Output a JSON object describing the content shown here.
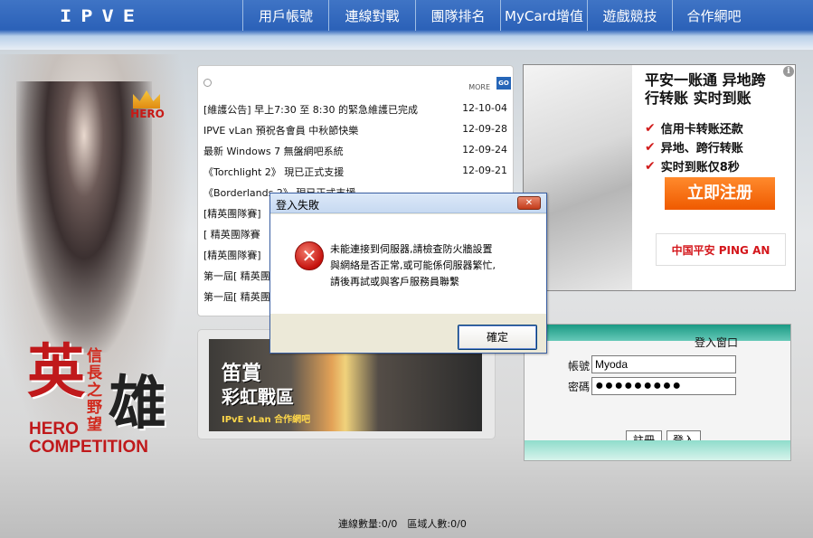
{
  "header": {
    "logo": "IPVE",
    "nav": [
      "用戶帳號",
      "連線對戰",
      "團隊排名",
      "MyCard增值",
      "遊戲競技",
      "合作網吧"
    ]
  },
  "hero": {
    "badge": "HERO",
    "title_char_1": "英",
    "title_char_2": "雄",
    "subtitle": "信長之野望",
    "competition_1": "HERO",
    "competition_2": "COMPETITION"
  },
  "news": {
    "more_label": "MORE",
    "go_label": "GO",
    "items": [
      {
        "title": "[維護公告] 早上7:30 至 8:30 的緊急維護已完成",
        "date": "12-10-04"
      },
      {
        "title": "IPVE vLan 預祝各會員 中秋節快樂",
        "date": "12-09-28"
      },
      {
        "title": "最新 Windows 7 無盤網吧系統",
        "date": "12-09-24"
      },
      {
        "title": "《Torchlight 2》 現已正式支援",
        "date": "12-09-21"
      },
      {
        "title": "《Borderlands 2》 現已正式支援",
        "date": ""
      },
      {
        "title": "[精英團隊賽]",
        "date": ""
      },
      {
        "title": "[ 精英團隊賽",
        "date": ""
      },
      {
        "title": "[精英團隊賽]",
        "date": ""
      },
      {
        "title": "第一屆[ 精英團",
        "date": ""
      },
      {
        "title": "第一屆[ 精英團",
        "date": ""
      }
    ]
  },
  "banner": {
    "line1": "笛賞",
    "line2": "彩虹戰區",
    "line3": "IPvE vLan 合作網吧"
  },
  "ad": {
    "headline_1": "平安一账通 异地跨",
    "headline_2": "行转账 实时到账",
    "features": [
      "信用卡转账还款",
      "异地、跨行转账",
      "实时到账仅8秒"
    ],
    "cta": "立即注册",
    "brand": "中国平安 PING AN"
  },
  "login": {
    "title": "登入窗口",
    "account_label": "帳號",
    "account_value": "Myoda",
    "password_label": "密碼",
    "password_value": "●●●●●●●●●",
    "register_label": "註冊",
    "login_label": "登入"
  },
  "footer": {
    "text": "連線數量:0/0　區域人數:0/0"
  },
  "dialog": {
    "title": "登入失敗",
    "message_1": "未能連接到伺服器,請檢查防火牆設置",
    "message_2": "與網絡是否正常,或可能係伺服器繁忙,",
    "message_3": "請後再試或與客戶服務員聯繫",
    "ok_label": "確定"
  },
  "colors": {
    "topbar": "#2b61b8",
    "accent_red": "#c0191b",
    "ad_button": "#ef5a00",
    "login_bar": "#1a9a84"
  }
}
